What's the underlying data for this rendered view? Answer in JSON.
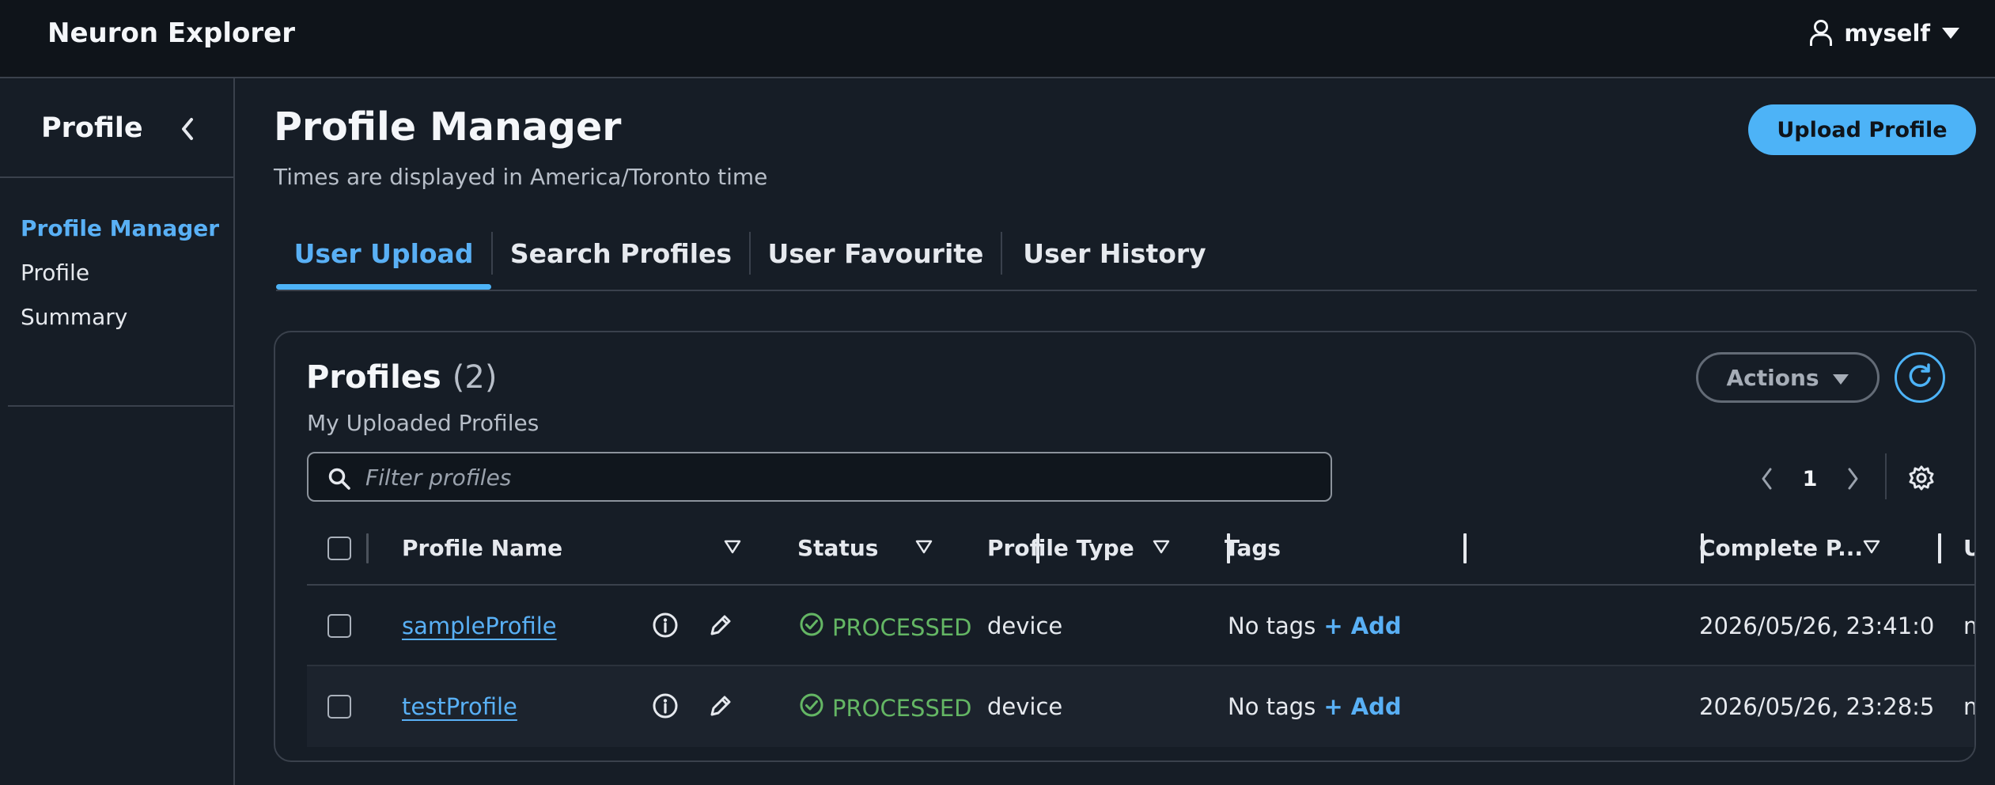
{
  "app": {
    "title": "Neuron Explorer"
  },
  "user": {
    "name": "myself",
    "icon": "user-icon",
    "caret": "caret-down-icon"
  },
  "sidebar": {
    "title": "Profile",
    "collapse_icon": "chevron-left-icon",
    "items": [
      {
        "label": "Profile Manager",
        "active": true
      },
      {
        "label": "Profile",
        "active": false
      },
      {
        "label": "Summary",
        "active": false
      }
    ]
  },
  "header": {
    "title": "Profile Manager",
    "subtitle": "Times are displayed in America/Toronto time",
    "upload_label": "Upload Profile"
  },
  "tabs": [
    {
      "label": "User Upload",
      "active": true
    },
    {
      "label": "Search Profiles",
      "active": false
    },
    {
      "label": "User Favourite",
      "active": false
    },
    {
      "label": "User History",
      "active": false
    }
  ],
  "profiles": {
    "title": "Profiles",
    "count": "(2)",
    "subtitle": "My Uploaded Profiles",
    "actions_label": "Actions",
    "filter_placeholder": "Filter profiles",
    "page": "1",
    "columns": [
      "Profile Name",
      "Status",
      "Profile Type",
      "Tags",
      "Complete P...",
      "Upl"
    ],
    "rows": [
      {
        "name": "sampleProfile",
        "status": "PROCESSED",
        "type": "device",
        "tags": "No tags",
        "add": "+ Add",
        "completed": "2026/05/26, 23:41:0",
        "uploader": "mys"
      },
      {
        "name": "testProfile",
        "status": "PROCESSED",
        "type": "device",
        "tags": "No tags",
        "add": "+ Add",
        "completed": "2026/05/26, 23:28:5",
        "uploader": "mys"
      }
    ]
  },
  "colors": {
    "accent": "#4db3f7",
    "link": "#59b0f5",
    "status_ok": "#64b664",
    "background": "#161d26",
    "topbar": "#0f141a"
  }
}
